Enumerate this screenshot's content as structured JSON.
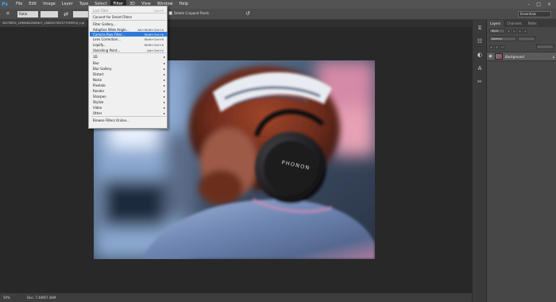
{
  "menubar": {
    "logo": "Ps",
    "items": [
      "File",
      "Edit",
      "Image",
      "Layer",
      "Type",
      "Select",
      "Filter",
      "3D",
      "View",
      "Window",
      "Help"
    ],
    "active_index": 6
  },
  "options_bar": {
    "ratio_label": "Ratio",
    "delete_cropped_label": "Delete Cropped Pixels",
    "workspace": "Essentials"
  },
  "document": {
    "tab_title": "58276692_20986842869407_2085627582077099904_n.jp"
  },
  "filter_menu": {
    "items": [
      {
        "label": "Last Filter",
        "shortcut": "Ctrl+F",
        "disabled": true
      },
      {
        "label": "Convert for Smart Filters"
      },
      {
        "label": "Filter Gallery..."
      },
      {
        "label": "Adaptive Wide Angle...",
        "shortcut": "Alt+Shift+Ctrl+A"
      },
      {
        "label": "Camera Raw Filter...",
        "shortcut": "Shift+Ctrl+A",
        "highlighted": true
      },
      {
        "label": "Lens Correction...",
        "shortcut": "Shift+Ctrl+R"
      },
      {
        "label": "Liquify...",
        "shortcut": "Shift+Ctrl+X"
      },
      {
        "label": "Vanishing Point...",
        "shortcut": "Alt+Ctrl+V"
      },
      {
        "label": "3D",
        "submenu": true
      },
      {
        "label": "Blur",
        "submenu": true
      },
      {
        "label": "Blur Gallery",
        "submenu": true
      },
      {
        "label": "Distort",
        "submenu": true
      },
      {
        "label": "Noise",
        "submenu": true
      },
      {
        "label": "Pixelate",
        "submenu": true
      },
      {
        "label": "Render",
        "submenu": true
      },
      {
        "label": "Sharpen",
        "submenu": true
      },
      {
        "label": "Stylize",
        "submenu": true
      },
      {
        "label": "Video",
        "submenu": true
      },
      {
        "label": "Other",
        "submenu": true
      },
      {
        "label": "Browse Filters Online..."
      }
    ]
  },
  "photo": {
    "headphone_text": "PHONON"
  },
  "layers_panel": {
    "tabs": [
      "Layers",
      "Channels",
      "Paths"
    ],
    "active_tab": 0,
    "kind_filter": "Kind",
    "blend_mode": "Normal",
    "layer_name": "Background"
  },
  "status_bar": {
    "zoom": "50%",
    "doc_info": "Doc: 7.46M/7.46M"
  },
  "colors": {
    "menu_highlight": "#2f7ad9",
    "app_bg": "#282828",
    "panel_bg": "#474747"
  }
}
